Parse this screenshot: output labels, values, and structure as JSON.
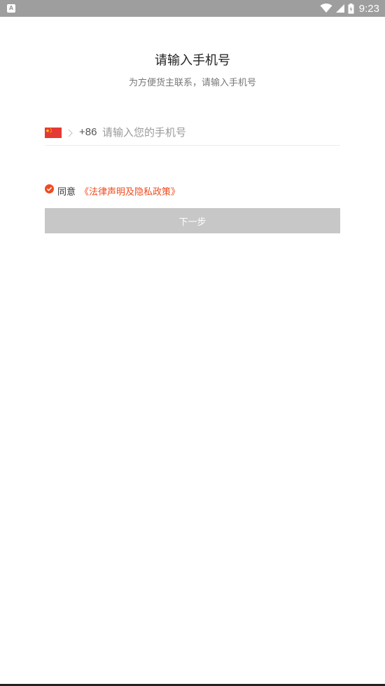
{
  "status_bar": {
    "app_icon": "A",
    "time": "9:23",
    "icons": [
      "wifi-icon",
      "signal-icon",
      "battery-charging-icon"
    ]
  },
  "header": {
    "title": "请输入手机号",
    "subtitle": "为方便货主联系，请输入手机号"
  },
  "phone": {
    "country_flag": "china-flag-icon",
    "dial_code": "+86",
    "placeholder": "请输入您的手机号",
    "value": ""
  },
  "agreement": {
    "checked": true,
    "label": "同意",
    "link": "《法律声明及隐私政策》"
  },
  "next_button": {
    "label": "下一步"
  },
  "colors": {
    "accent": "#f04b1e",
    "status_bar": "#9e9e9e",
    "button_disabled": "#c7c7c7"
  }
}
